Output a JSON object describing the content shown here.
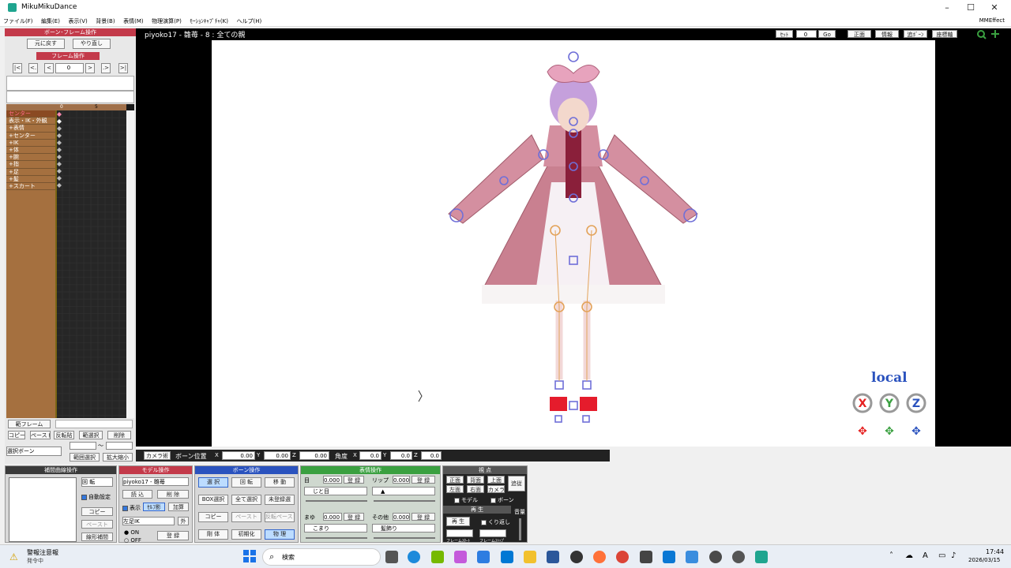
{
  "window": {
    "title": "MikuMikuDance",
    "minimize": "–",
    "maximize": "☐",
    "close": "✕"
  },
  "menu": [
    "ファイル(F)",
    "編集(E)",
    "表示(V)",
    "背景(B)",
    "表情(M)",
    "物理演算(P)",
    "ﾓｰｼｮﾝｷｬﾌﾟﾁｬ(K)",
    "ヘルプ(H)"
  ],
  "mmeffect": "MMEffect",
  "bone_frame_panel": {
    "title": "ボーン･フレーム操作",
    "undo": "元に戻す",
    "redo": "やり直し",
    "frame_ops": "フレーム操作",
    "frame_value": "0"
  },
  "timeline": {
    "header_nums": [
      "0",
      "5"
    ],
    "rows": [
      "センター",
      "表示・IK・外観",
      "+表情",
      "+センター",
      "+IK",
      "+体",
      "+腕",
      "+指",
      "+足",
      "+髪",
      "+スカート"
    ]
  },
  "left_bottom": {
    "frame_select": "範フレーム",
    "copy": "コピー",
    "paste": "ペースト",
    "reverse": "反転貼",
    "range_select": "範選択",
    "delete": "削除",
    "select_bone": "選択ボーン",
    "range_paste": "範囲選択",
    "expand": "拡大縮小",
    "tilde": "〜"
  },
  "viewport": {
    "title": "piyoko17 - 雛苺 - 8 : 全ての親",
    "frame_label": "ｾｯﾄ",
    "frame_value": "0",
    "go": "Go",
    "view_buttons": [
      "正面",
      "情報",
      "追ﾎﾞｰﾝ",
      "座標軸"
    ],
    "local_label": "local"
  },
  "bone_pos_bar": {
    "camera": "カメラ術",
    "pos_label": "ボーン位置",
    "x": "0.00",
    "y": "0.00",
    "z": "0.00",
    "angle_label": "角度",
    "ax": "0.0",
    "ay": "0.0",
    "az": "0.0"
  },
  "interp": {
    "title": "補間曲線操作",
    "rotation": "回 転",
    "auto": "自動設定",
    "copy": "コピー",
    "paste": "ペースト",
    "linear": "線形補間"
  },
  "model": {
    "title": "モデル操作",
    "selected": "piyoko17 - 雛苺",
    "load": "読 込",
    "delete": "削 除",
    "show": "表示",
    "shadow": "ｾﾙﾌ影",
    "addsync": "加算",
    "bone": "左足IK",
    "outside": "外",
    "on": "ON",
    "off": "OFF",
    "register": "登 録"
  },
  "bone_ops": {
    "title": "ボーン操作",
    "select": "選 択",
    "rotate": "回 転",
    "move": "移 動",
    "box": "BOX選択",
    "all": "全て選択",
    "unreg": "未登録選",
    "copy": "コピー",
    "paste": "ペースト",
    "revpaste": "反転ペースト",
    "physics": "剛 体",
    "init": "初期化",
    "phys": "物 理"
  },
  "morph": {
    "title": "表情操作",
    "eye": "目",
    "eye_val": "0.000",
    "reg": "登 録",
    "lip": "リップ",
    "lip_val": "0.000",
    "eye_sel": "じと目",
    "lip_sel": "▲",
    "brow": "まゆ",
    "brow_val": "0.000",
    "other": "その他",
    "other_val": "0.000",
    "brow_sel": "こまり",
    "other_sel": "髪飾り"
  },
  "viewpoint": {
    "title": "視 点",
    "front": "正面",
    "back": "背面",
    "top": "上面",
    "left": "左面",
    "right": "右面",
    "camera": "カメラ",
    "track": "追従",
    "model_chk": "モデル",
    "bone_chk": "ボーン"
  },
  "play": {
    "title": "再 生",
    "play": "再 生",
    "repeat": "くり返し",
    "volume": "音量",
    "from_frame": "フレームｽﾀｰﾄ",
    "to_frame": "フレームｽﾄｯﾌﾟ"
  },
  "taskbar": {
    "warn_title": "警報注意報",
    "warn_sub": "発令中",
    "search": "検索",
    "time": "17:44",
    "date": "2026/03/15"
  },
  "colors": {
    "accent_red": "#c33a4a",
    "accent_blue": "#2a52be",
    "green": "#3aa040"
  }
}
